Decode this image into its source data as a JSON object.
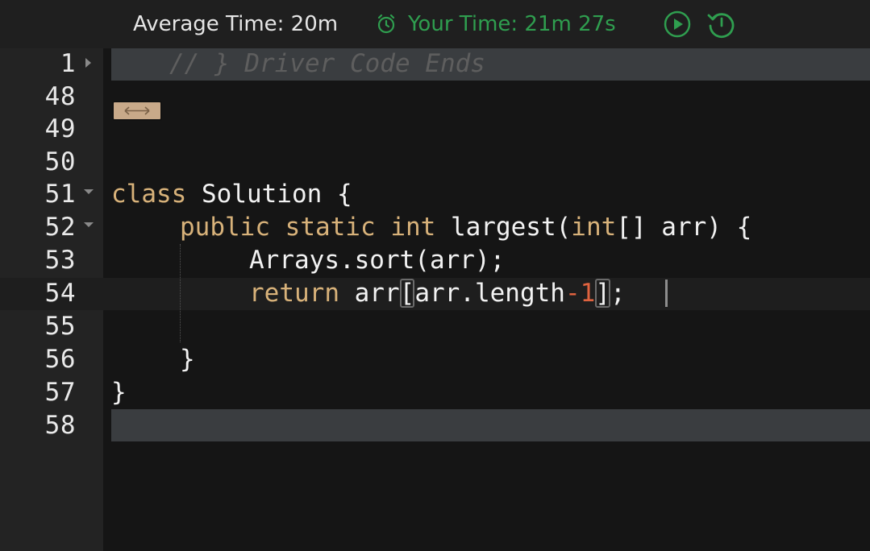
{
  "header": {
    "average_time": "Average Time: 20m",
    "your_time": "Your Time: 21m 27s",
    "accent_green": "#2f9e4f",
    "icons": [
      "alarm-clock-icon",
      "play-icon",
      "reset-timer-icon"
    ]
  },
  "editor": {
    "language": "java",
    "current_line": "54",
    "lines": [
      {
        "number": "1",
        "text": "// } Driver Code Ends"
      },
      {
        "number": "48",
        "text": ""
      },
      {
        "number": "49",
        "text": ""
      },
      {
        "number": "50",
        "text": ""
      },
      {
        "number": "51",
        "text": "class Solution {"
      },
      {
        "number": "52",
        "text": "    public static int largest(int[] arr) {"
      },
      {
        "number": "53",
        "text": "        Arrays.sort(arr);"
      },
      {
        "number": "54",
        "text": "        return arr[arr.length-1];"
      },
      {
        "number": "55",
        "text": ""
      },
      {
        "number": "56",
        "text": "    }"
      },
      {
        "number": "57",
        "text": "}"
      },
      {
        "number": "58",
        "text": ""
      }
    ],
    "tokens": {
      "l1_comment": "// } Driver Code Ends",
      "class_kw": "class",
      "class_name": " Solution {",
      "public_kw": "public",
      "static_kw": "static",
      "int_kw": "int",
      "method": " largest(",
      "int_kw2": "int",
      "params": "[] arr) {",
      "l53": "Arrays.sort(arr);",
      "return_kw": "return",
      "arr": " arr",
      "lbr": "[",
      "len": "arr.length",
      "minus": "-",
      "one": "1",
      "rbr": "]",
      "semi": ";",
      "close_method": "}",
      "close_class": "}"
    }
  }
}
